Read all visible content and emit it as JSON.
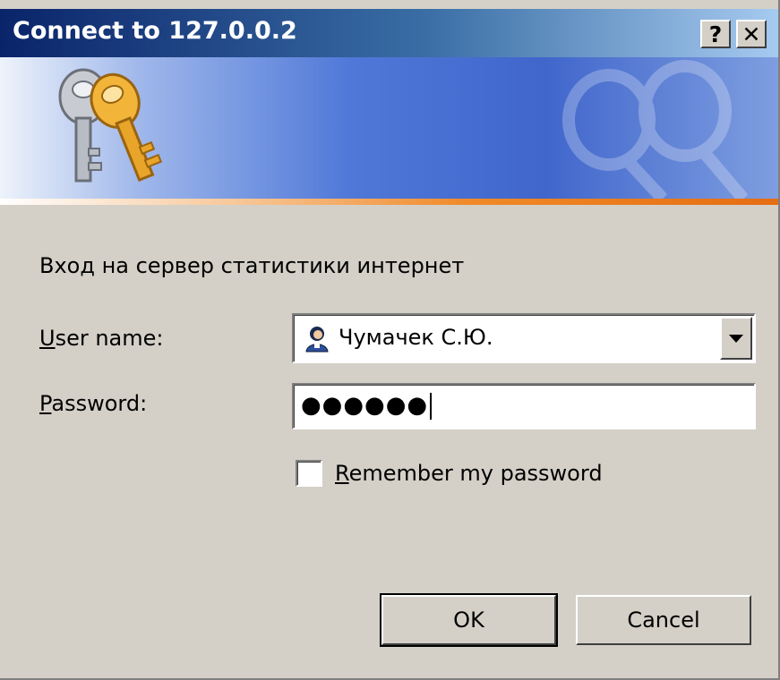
{
  "window": {
    "title": "Connect to 127.0.0.2",
    "help_button": "?",
    "close_button": "✕"
  },
  "prompt_text": "Вход на сервер статистики интернет",
  "fields": {
    "username": {
      "label_underline": "U",
      "label_rest": "ser name:",
      "value": "Чумачек С.Ю."
    },
    "password": {
      "label_underline": "P",
      "label_rest": "assword:",
      "value": "●●●●●●"
    }
  },
  "remember": {
    "label_underline": "R",
    "label_rest": "emember my password",
    "checked": false
  },
  "buttons": {
    "ok": "OK",
    "cancel": "Cancel"
  },
  "colors": {
    "titlebar_start": "#0a246a",
    "titlebar_end": "#a6caf0",
    "face": "#d4d0c8",
    "banner_accent": "#f08a2a"
  }
}
